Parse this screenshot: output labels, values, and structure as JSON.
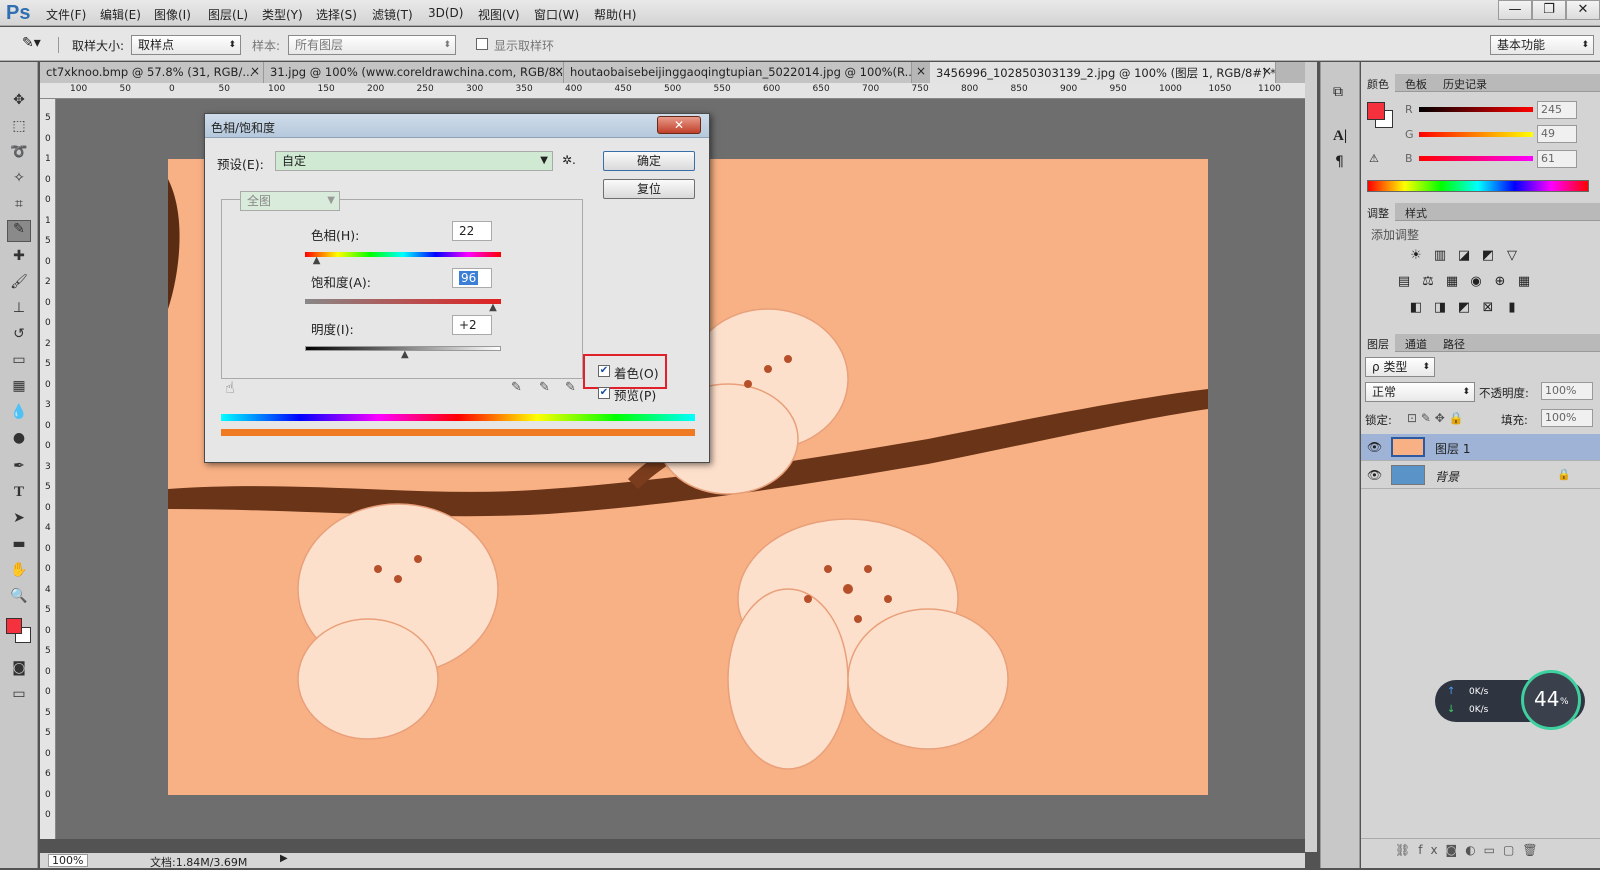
{
  "menubar": {
    "logo": "Ps",
    "items": [
      "文件(F)",
      "编辑(E)",
      "图像(I)",
      "图层(L)",
      "类型(Y)",
      "选择(S)",
      "滤镜(T)",
      "3D(D)",
      "视图(V)",
      "窗口(W)",
      "帮助(H)"
    ],
    "win_min": "—",
    "win_restore": "❐",
    "win_close": "✕"
  },
  "options": {
    "sample_size_label": "取样大小:",
    "sample_size_value": "取样点",
    "sample_label": "样本:",
    "sample_value": "所有图层",
    "show_ring_label": "显示取样环",
    "workspace": "基本功能"
  },
  "tabs": [
    "ct7xknoo.bmp @ 57.8% (31, RGB/...",
    "31.jpg @ 100% (www.coreldrawchina.com, RGB/8...",
    "houtaobaisebeijinggaoqingtupian_5022014.jpg @ 100%(R...",
    "3456996_102850303139_2.jpg @ 100% (图层 1, RGB/8#) *"
  ],
  "tab_close": "×",
  "ruler_top": [
    "100",
    "50",
    "0",
    "50",
    "100",
    "150",
    "200",
    "250",
    "300",
    "350",
    "400",
    "450",
    "500",
    "550",
    "600",
    "650",
    "700",
    "750",
    "800",
    "850",
    "900",
    "950",
    "1000",
    "1050",
    "1100"
  ],
  "ruler_left": [
    "5",
    "0",
    "1",
    "0",
    "0",
    "1",
    "5",
    "0",
    "2",
    "0",
    "0",
    "2",
    "5",
    "0",
    "3",
    "0",
    "0",
    "3",
    "5",
    "0",
    "4",
    "0",
    "0",
    "4",
    "5",
    "0",
    "5",
    "0",
    "0",
    "5",
    "5",
    "0",
    "6",
    "0",
    "0"
  ],
  "status": {
    "zoom": "100%",
    "doc": "文档:1.84M/3.69M"
  },
  "dialog": {
    "title": "色相/饱和度",
    "close": "✕",
    "preset_label": "预设(E):",
    "preset_value": "自定",
    "ok": "确定",
    "reset": "复位",
    "channel": "全图",
    "hue_label": "色相(H):",
    "hue_value": "22",
    "saturation_label": "饱和度(A):",
    "saturation_value": "96",
    "lightness_label": "明度(I):",
    "lightness_value": "+2",
    "colorize_label": "着色(O)",
    "preview_label": "预览(P)",
    "colorize_checked": true,
    "preview_checked": true,
    "hue_level": 0.06,
    "saturation_level": 0.96,
    "lightness_level": 0.51
  },
  "color_panel": {
    "tabs": [
      "颜色",
      "色板",
      "历史记录"
    ],
    "r_label": "R",
    "g_label": "G",
    "b_label": "B",
    "r_value": "245",
    "g_value": "49",
    "b_value": "61",
    "foreground": "#f5313d"
  },
  "adjust_panel": {
    "tabs": [
      "调整",
      "样式"
    ],
    "add_label": "添加调整",
    "row1": [
      "☀",
      "▥",
      "◪",
      "◩",
      "▽"
    ],
    "row2": [
      "▤",
      "⚖",
      "▦",
      "◉",
      "⊕",
      "▦"
    ],
    "row3": [
      "◧",
      "◨",
      "◩",
      "⊠",
      "▮"
    ]
  },
  "layers_panel": {
    "tabs": [
      "图层",
      "通道",
      "路径"
    ],
    "filter_label": "ρ 类型",
    "blend_mode": "正常",
    "opacity_label": "不透明度:",
    "opacity_value": "100%",
    "lock_label": "锁定:",
    "fill_label": "填充:",
    "fill_value": "100%",
    "layers": [
      {
        "name": "图层 1",
        "selected": true
      },
      {
        "name": "背景",
        "selected": false
      }
    ]
  },
  "net_widget": {
    "up": "0K/s",
    "down": "0K/s",
    "percent": "44",
    "percent_suffix": "%"
  }
}
